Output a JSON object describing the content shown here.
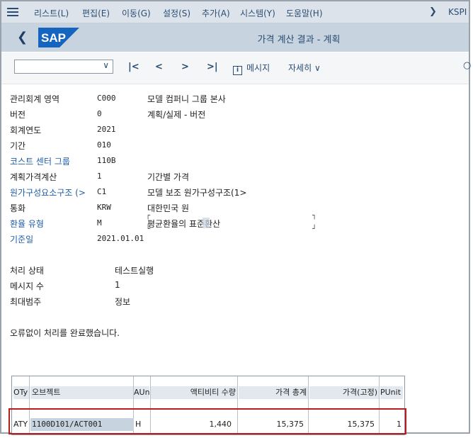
{
  "menubar": {
    "items": [
      "리스트(L)",
      "편집(E)",
      "이동(G)",
      "설정(S)",
      "추가(A)",
      "시스템(Y)",
      "도움말(H)"
    ],
    "system_id": "KSPI"
  },
  "header": {
    "logo_text": "SAP",
    "title": "가격 계산 결과 - 계획"
  },
  "toolbar": {
    "combo_value": "",
    "messages_label": "메시지",
    "details_label": "자세히"
  },
  "params": [
    {
      "label": "관리회계 영역",
      "value": "C000",
      "desc": "모델 컴퍼니 그룹 본사"
    },
    {
      "label": "버전",
      "value": "0",
      "desc": "계획/실제 - 버전"
    },
    {
      "label": "회계연도",
      "value": "2021",
      "desc": ""
    },
    {
      "label": "기간",
      "value": "010",
      "desc": ""
    },
    {
      "label": "코스트 센터 그룹",
      "value": "110B",
      "desc": ""
    },
    {
      "label": "계획가격계산",
      "value": "1",
      "desc": "기간별 가격"
    },
    {
      "label": "원가구성요소구조 (>",
      "value": "C1",
      "desc": "모델 보조 원가구성구조(1>"
    },
    {
      "label": "통화",
      "value": "KRW",
      "desc": "대한민국 원"
    },
    {
      "label": "환율 유형",
      "value": "M",
      "desc": "평균환율의 표준환산"
    },
    {
      "label": "기준일",
      "value": "2021.01.01",
      "desc": ""
    }
  ],
  "status": [
    {
      "label": "처리 상태",
      "value": "테스트실행"
    },
    {
      "label": "메시지 수",
      "value": "1"
    },
    {
      "label": "최대범주",
      "value": "정보"
    }
  ],
  "completion_message": "오류없이 처리를 완료했습니다.",
  "table": {
    "headers": [
      "OTy",
      "오브젝트",
      "AUn",
      "액티비티 수량",
      "가격 총계",
      "가격(고정)",
      "PUnit"
    ],
    "rows": [
      [
        "ATY",
        "1100D101/ACT001",
        "H",
        "1,440",
        "15,375",
        "15,375",
        "1"
      ]
    ]
  },
  "colors": {
    "menubar_bg": "#dde3ea",
    "header_bg": "#c7d3df",
    "brand_blue": "#1565c0",
    "highlight_border": "#b81c1c"
  }
}
